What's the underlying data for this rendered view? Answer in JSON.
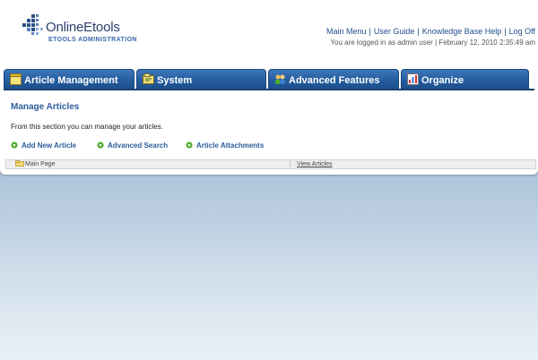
{
  "logo": {
    "title": "OnlineEtools",
    "subtitle": "ETOOLS ADMINISTRATION"
  },
  "header": {
    "links": [
      "Main Menu",
      "User Guide",
      "Knowledge Base Help",
      "Log Off"
    ],
    "separator": "|",
    "login_status": "You are logged in as admin user | February 12, 2010 2:35:49 am"
  },
  "tabs": [
    {
      "label": "Article Management",
      "icon": "notepad-icon"
    },
    {
      "label": "System",
      "icon": "folder-icon"
    },
    {
      "label": "Advanced Features",
      "icon": "users-icon"
    },
    {
      "label": "Organize",
      "icon": "chart-icon"
    }
  ],
  "main": {
    "heading": "Manage Articles",
    "description": "From this section you can manage your articles.",
    "actions": [
      "Add New Article",
      "Advanced Search",
      "Article Attachments"
    ],
    "table": {
      "folder_label": "Main Page",
      "link_label": "View Articles"
    }
  },
  "colors": {
    "tab_blue": "#245d9e",
    "link_blue": "#1f4d8c",
    "heading_blue": "#2e5e9e",
    "action_green": "#4caf2e"
  }
}
